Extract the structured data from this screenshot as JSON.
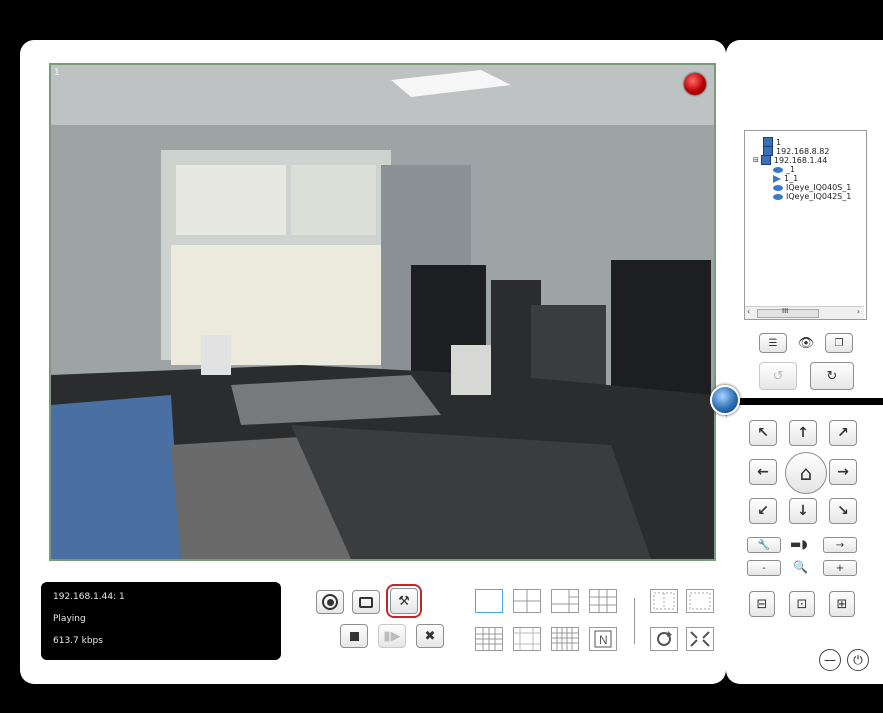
{
  "video": {
    "channel_number": "1",
    "recording_indicator": "red-record-dot-icon"
  },
  "status": {
    "source": "192.168.1.44: 1",
    "state": "Playing",
    "bitrate": "613.7 kbps"
  },
  "playback_controls": {
    "top_row": [
      "record-icon",
      "snapshot-icon",
      "settings-tools-icon"
    ],
    "bottom_row": [
      "stop-icon",
      "step-forward-icon",
      "close-icon"
    ]
  },
  "tree": {
    "items": [
      {
        "label": "1",
        "type": "server"
      },
      {
        "label": "192.168.8.82",
        "type": "server"
      },
      {
        "label": "192.168.1.44",
        "type": "server"
      },
      {
        "label": "_1",
        "type": "camera"
      },
      {
        "label": "1_1",
        "type": "playing"
      },
      {
        "label": "IQeye_IQ040S_1",
        "type": "camera"
      },
      {
        "label": "IQeye_IQ042S_1",
        "type": "camera"
      }
    ],
    "scroll_label": "III"
  },
  "ptz": {
    "zoom_label_minus": "-",
    "zoom_label_plus": "+",
    "focus_arrow": "→"
  },
  "colors": {
    "accent_blue": "#4aa8e8",
    "highlight_red": "#c0292b",
    "record_red": "#c00000"
  }
}
